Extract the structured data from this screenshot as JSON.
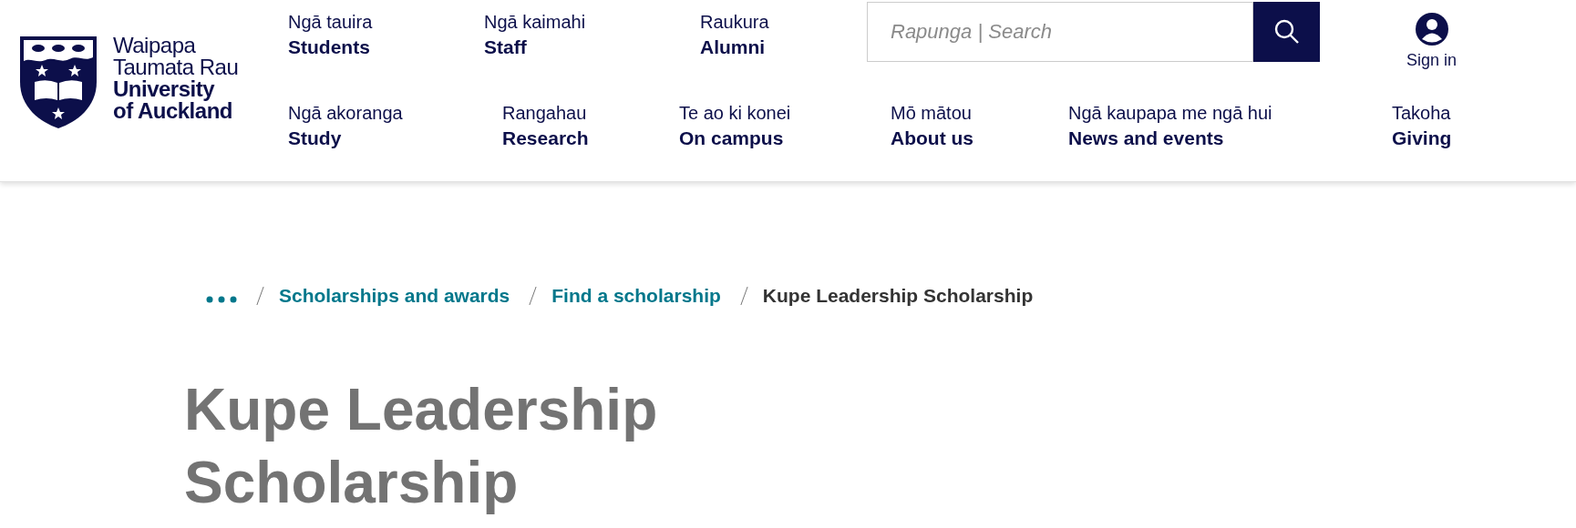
{
  "logo": {
    "lines": [
      {
        "text": "Waipapa",
        "bold": false
      },
      {
        "text": "Taumata Rau",
        "bold": false
      },
      {
        "text": "University",
        "bold": true
      },
      {
        "text": "of Auckland",
        "bold": true
      }
    ]
  },
  "top_links": [
    {
      "maori": "Ngā tauira",
      "english": "Students"
    },
    {
      "maori": "Ngā kaimahi",
      "english": "Staff"
    },
    {
      "maori": "Raukura",
      "english": "Alumni"
    }
  ],
  "search": {
    "placeholder": "Rapunga | Search"
  },
  "sign_in": {
    "label": "Sign in"
  },
  "main_nav": [
    {
      "maori": "Ngā akoranga",
      "english": "Study"
    },
    {
      "maori": "Rangahau",
      "english": "Research"
    },
    {
      "maori": "Te ao ki konei",
      "english": "On campus"
    },
    {
      "maori": "Mō mātou",
      "english": "About us"
    },
    {
      "maori": "Ngā kaupapa me ngā hui",
      "english": "News and events"
    },
    {
      "maori": "Takoha",
      "english": "Giving"
    }
  ],
  "breadcrumb": [
    {
      "label": "Scholarships and awards",
      "kind": "link"
    },
    {
      "label": "Find a scholarship",
      "kind": "link"
    },
    {
      "label": "Kupe Leadership Scholarship",
      "kind": "current"
    }
  ],
  "page_title": "Kupe Leadership Scholarship"
}
